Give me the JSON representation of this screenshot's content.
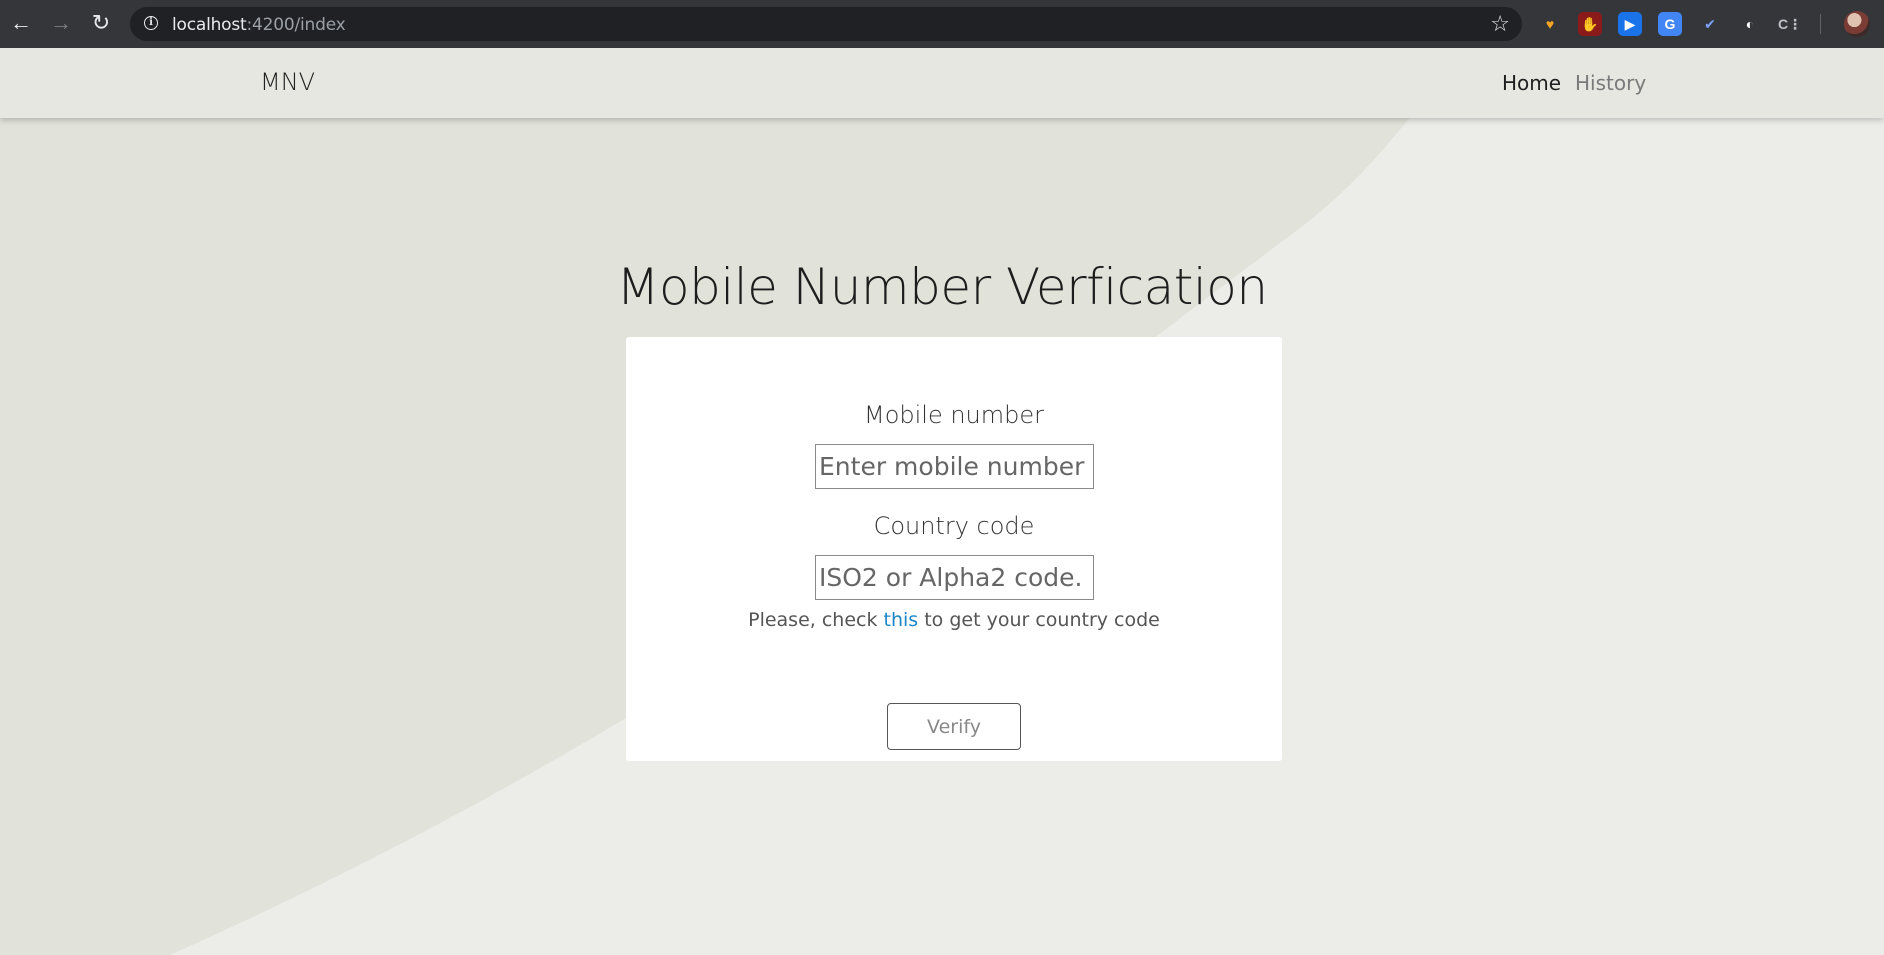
{
  "browser": {
    "url_host": "localhost",
    "url_rest": ":4200/index",
    "icons": {
      "back": "arrow-left-icon",
      "forward": "arrow-right-icon",
      "reload": "reload-icon",
      "info": "info-icon",
      "bookmark": "star-icon"
    },
    "extensions": [
      {
        "name": "heart-extension-icon",
        "glyph": "♥",
        "bg": "#35363a",
        "fg": "#f6a623"
      },
      {
        "name": "hand-stop-extension-icon",
        "glyph": "✋",
        "bg": "#8b1a1a",
        "fg": "#ffffff"
      },
      {
        "name": "screen-share-extension-icon",
        "glyph": "▶",
        "bg": "#1a73e8",
        "fg": "#ffffff"
      },
      {
        "name": "translate-extension-icon",
        "glyph": "G",
        "bg": "#4285f4",
        "fg": "#ffffff"
      },
      {
        "name": "checkmark-extension-icon",
        "glyph": "✔",
        "bg": "#35363a",
        "fg": "#7aa2f7"
      },
      {
        "name": "circle-extension-icon",
        "glyph": "◐",
        "bg": "#35363a",
        "fg": "#ffffff"
      },
      {
        "name": "c-extension-icon",
        "glyph": "C⋮",
        "bg": "#35363a",
        "fg": "#bdc1c6"
      }
    ]
  },
  "nav": {
    "brand": "MNV",
    "links": [
      {
        "label": "Home",
        "active": true
      },
      {
        "label": "History",
        "active": false
      }
    ]
  },
  "main": {
    "title": "Mobile Number Verfication",
    "form": {
      "mobile_label": "Mobile number",
      "mobile_placeholder": "Enter mobile number",
      "mobile_value": "",
      "country_label": "Country code",
      "country_placeholder": "ISO2 or Alpha2 code.",
      "country_value": "",
      "hint_before": "Please, check ",
      "hint_link": "this",
      "hint_after": " to get your country code",
      "verify_label": "Verify"
    }
  },
  "colors": {
    "link": "#1a86c8",
    "background": "#e5e6df",
    "card": "#ffffff"
  }
}
